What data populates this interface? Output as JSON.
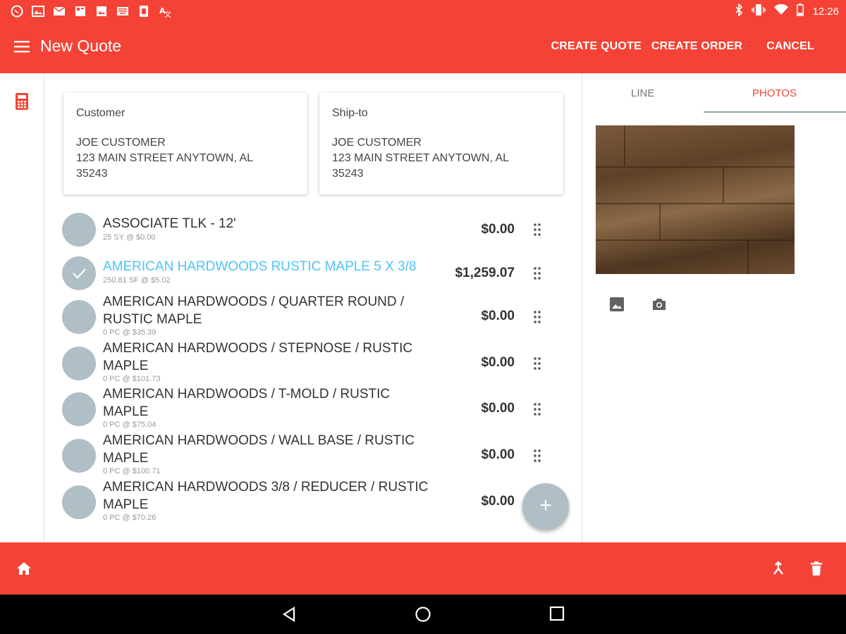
{
  "status_bar": {
    "time": "12:26",
    "left_icons": [
      "whatsapp-icon",
      "photo-icon",
      "mail-icon",
      "news-icon",
      "image-icon",
      "keyboard-icon",
      "sim-icon",
      "translate-icon"
    ],
    "right_icons": [
      "bluetooth-icon",
      "vibrate-icon",
      "wifi-icon",
      "battery-icon"
    ]
  },
  "app_bar": {
    "title": "New Quote",
    "actions": [
      "CREATE QUOTE",
      "CREATE ORDER",
      "CANCEL"
    ]
  },
  "customer": {
    "label": "Customer",
    "name": "JOE CUSTOMER",
    "address": "123 MAIN STREET ANYTOWN, AL",
    "zip": "35243"
  },
  "ship_to": {
    "label": "Ship-to",
    "name": "JOE CUSTOMER",
    "address": "123 MAIN STREET ANYTOWN, AL",
    "zip": "35243"
  },
  "items": [
    {
      "name": "ASSOCIATE TLK - 12'",
      "sub": "25 SY @ $0.00",
      "price": "$0.00",
      "selected": false
    },
    {
      "name": "AMERICAN HARDWOODS RUSTIC MAPLE 5 X 3/8",
      "sub": "250.81 SF @ $5.02",
      "price": "$1,259.07",
      "selected": true
    },
    {
      "name": "AMERICAN HARDWOODS / QUARTER ROUND / RUSTIC MAPLE",
      "sub": "0 PC @ $35.39",
      "price": "$0.00",
      "selected": false
    },
    {
      "name": "AMERICAN HARDWOODS / STEPNOSE / RUSTIC MAPLE",
      "sub": "0 PC @ $101.73",
      "price": "$0.00",
      "selected": false
    },
    {
      "name": "AMERICAN HARDWOODS / T-MOLD / RUSTIC MAPLE",
      "sub": "0 PC @ $75.04",
      "price": "$0.00",
      "selected": false
    },
    {
      "name": "AMERICAN HARDWOODS / WALL BASE / RUSTIC MAPLE",
      "sub": "0 PC @ $100.71",
      "price": "$0.00",
      "selected": false
    },
    {
      "name": "AMERICAN HARDWOODS 3/8 / REDUCER / RUSTIC MAPLE",
      "sub": "0 PC @ $70.26",
      "price": "$0.00",
      "selected": false
    }
  ],
  "fab": {
    "label": "+"
  },
  "right_panel": {
    "tabs": [
      "LINE",
      "PHOTOS"
    ],
    "active_tab": "PHOTOS"
  },
  "colors": {
    "primary": "#f44336",
    "selected_text": "#4fc3f7",
    "avatar": "#b0bec5"
  }
}
